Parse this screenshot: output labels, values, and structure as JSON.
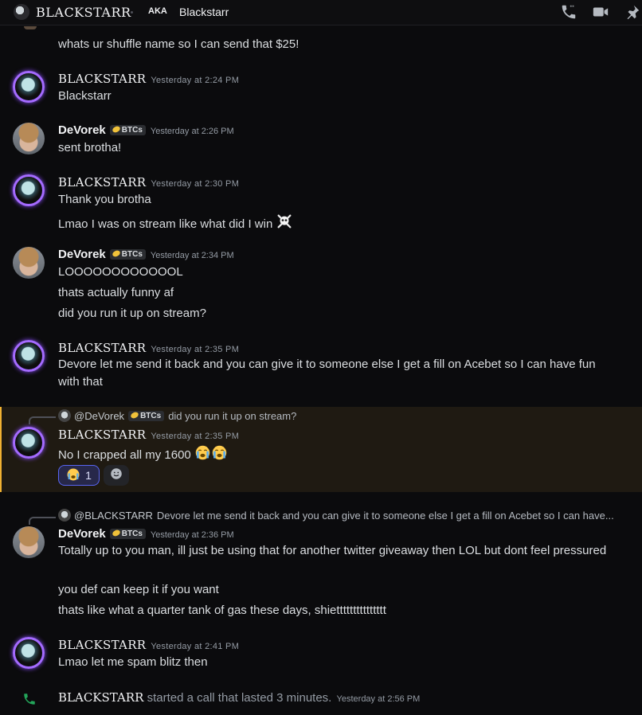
{
  "header": {
    "title": "BLACKSTARR",
    "aka_label": "AKA",
    "nickname": "Blackstarr"
  },
  "colors": {
    "background": "#0b0b0d",
    "highlight_border": "#f0b132",
    "call_green": "#23a55a",
    "reaction_blue": "#5865f2"
  },
  "messages": {
    "m0": {
      "text": "whats ur shuffle name so I can send that $25!"
    },
    "m1": {
      "author": "BLACKSTARR",
      "time": "Yesterday at 2:24 PM",
      "lines": [
        "Blackstarr"
      ]
    },
    "m2": {
      "author": "DeVorek",
      "tag": "BTCs",
      "time": "Yesterday at 2:26 PM",
      "lines": [
        "sent brotha!"
      ]
    },
    "m3": {
      "author": "BLACKSTARR",
      "time": "Yesterday at 2:30 PM",
      "lines": [
        "Thank you brotha",
        "Lmao I was on stream like what did I win"
      ]
    },
    "m4": {
      "author": "DeVorek",
      "tag": "BTCs",
      "time": "Yesterday at 2:34 PM",
      "lines": [
        "LOOOOOOOOOOOOL",
        "thats actually funny af",
        "did you run it up on stream?"
      ]
    },
    "m5": {
      "author": "BLACKSTARR",
      "time": "Yesterday at 2:35 PM",
      "lines": [
        "Devore let me send it back and you can give it to someone else I get a fill on Acebet so I can have fun with that"
      ]
    },
    "m6": {
      "reply_author": "@DeVorek",
      "reply_tag": "BTCs",
      "reply_text": "did you run it up on stream?",
      "author": "BLACKSTARR",
      "time": "Yesterday at 2:35 PM",
      "lines": [
        "No I crapped all my 1600"
      ],
      "reaction_count": "1"
    },
    "m7": {
      "reply_author": "@BLACKSTARR",
      "reply_text": "Devore let me send it back and you can give it to someone else I get a fill on Acebet so I can have...",
      "author": "DeVorek",
      "tag": "BTCs",
      "time": "Yesterday at 2:36 PM",
      "lines": [
        "Totally up to you man, ill just be using that for another twitter giveaway then LOL but dont feel pressured",
        "you def can keep it if you want",
        "thats like what a quarter tank of gas these days, shiettttttttttttttt"
      ]
    },
    "m8": {
      "author": "BLACKSTARR",
      "time": "Yesterday at 2:41 PM",
      "lines": [
        "Lmao let me spam blitz then"
      ]
    },
    "call": {
      "author": "BLACKSTARR",
      "text": "started a call that lasted 3 minutes.",
      "time": "Yesterday at 2:56 PM"
    }
  },
  "icons": [
    "voice-call-icon",
    "video-call-icon",
    "pin-icon",
    "skull-crossbones-emoji",
    "loudly-crying-emoji",
    "add-reaction-icon",
    "phone-icon"
  ]
}
